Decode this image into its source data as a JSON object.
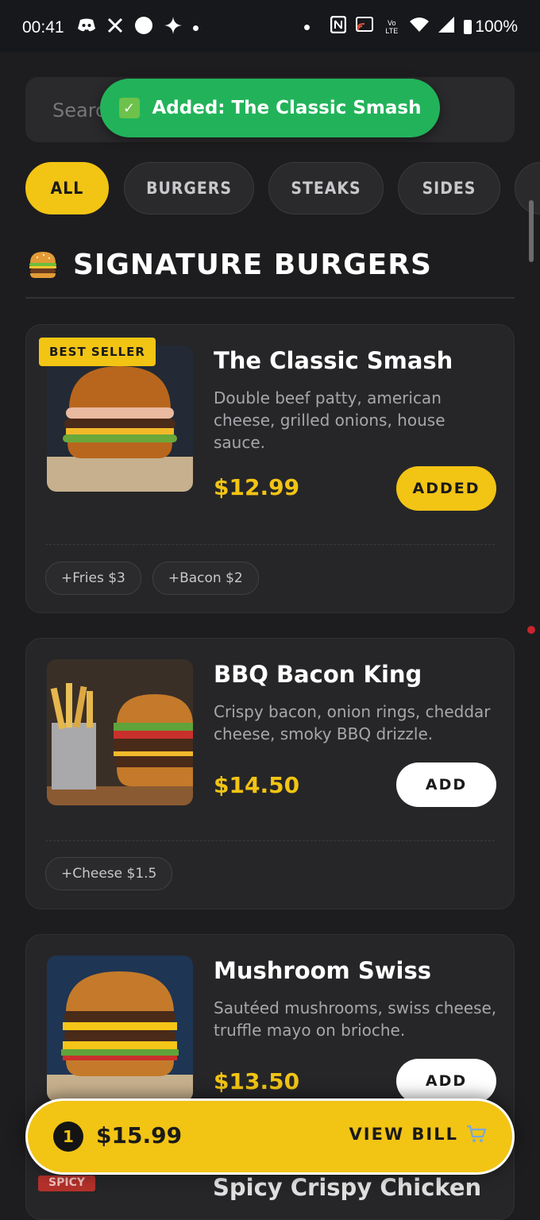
{
  "status_bar": {
    "time": "00:41",
    "battery": "100%",
    "icons_left": [
      "discord-icon",
      "x-icon",
      "circle-icon",
      "sparkle-icon",
      "dot-icon"
    ],
    "icons_right": [
      "dot-icon",
      "nfc-icon",
      "cast-icon",
      "volte-icon",
      "wifi-icon",
      "signal-icon",
      "battery-icon"
    ],
    "volte_label": "Vo LTE"
  },
  "search": {
    "placeholder": "Search"
  },
  "toast": {
    "icon": "check-icon",
    "text": "Added: The Classic Smash"
  },
  "tabs": [
    {
      "label": "ALL",
      "active": true
    },
    {
      "label": "BURGERS",
      "active": false
    },
    {
      "label": "STEAKS",
      "active": false
    },
    {
      "label": "SIDES",
      "active": false
    }
  ],
  "section": {
    "emoji": "burger-icon",
    "title": "SIGNATURE BURGERS"
  },
  "items": [
    {
      "badge": "BEST SELLER",
      "name": "The Classic Smash",
      "description": "Double beef patty, american cheese, grilled onions, house sauce.",
      "price": "$12.99",
      "button": "ADDED",
      "added": true,
      "extras": [
        "+Fries $3",
        "+Bacon $2"
      ]
    },
    {
      "badge": "",
      "name": "BBQ Bacon King",
      "description": "Crispy bacon, onion rings, cheddar cheese, smoky BBQ drizzle.",
      "price": "$14.50",
      "button": "ADD",
      "added": false,
      "extras": [
        "+Cheese $1.5"
      ]
    },
    {
      "badge": "",
      "name": "Mushroom Swiss",
      "description": "Sautéed mushrooms, swiss cheese, truffle mayo on brioche.",
      "price": "$13.50",
      "button": "ADD",
      "added": false,
      "extras": []
    }
  ],
  "peek_item": {
    "badge": "SPICY",
    "name": "Spicy Crispy Chicken"
  },
  "cart": {
    "count": "1",
    "total": "$15.99",
    "view_bill_label": "VIEW BILL",
    "icon": "cart-icon"
  },
  "colors": {
    "accent": "#f2c414",
    "background": "#1d1d1f",
    "card": "#262628",
    "toast": "#22b35a"
  }
}
